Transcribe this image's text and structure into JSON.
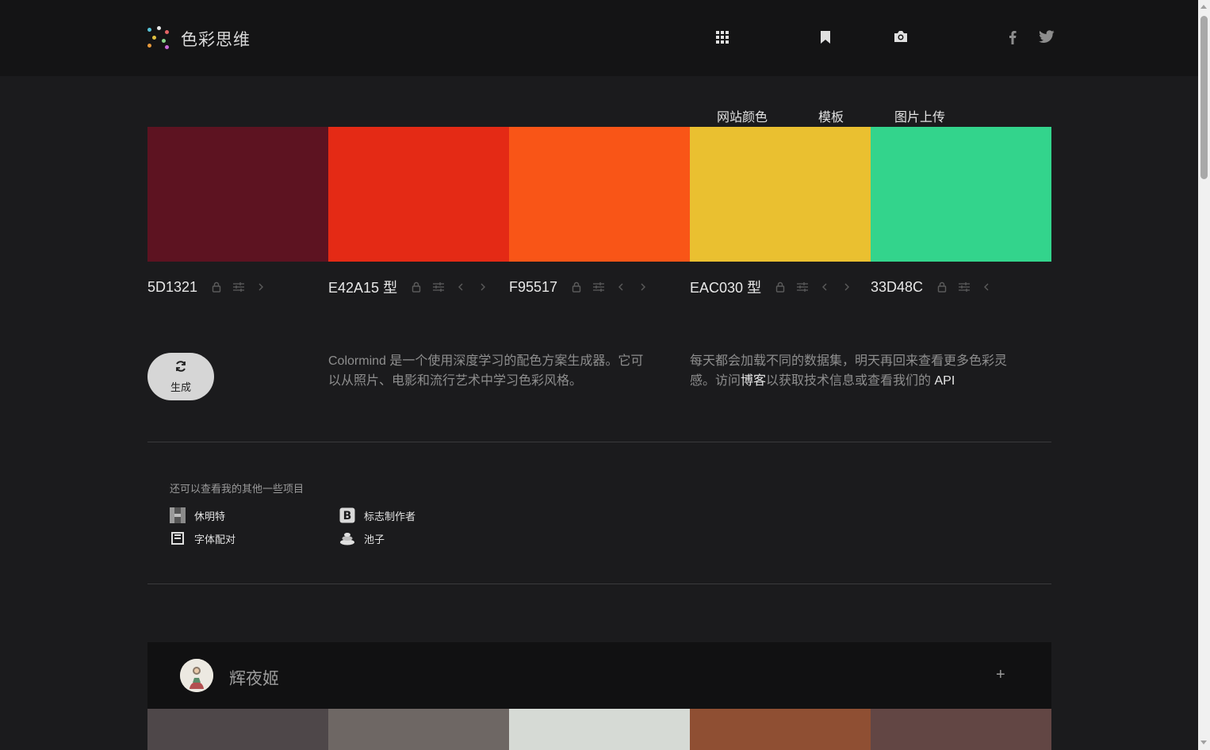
{
  "header": {
    "brand": "色彩思维",
    "nav": [
      {
        "label": "网站颜色",
        "icon": "grid-icon"
      },
      {
        "label": "模板",
        "icon": "bookmark-icon"
      },
      {
        "label": "图片上传",
        "icon": "camera-icon"
      }
    ],
    "social": [
      "facebook-icon",
      "twitter-icon"
    ]
  },
  "palette": {
    "colors": [
      {
        "hex": "5D1321",
        "color": "#5D1321",
        "suffix": ""
      },
      {
        "hex": "E42A15",
        "color": "#E42A15",
        "suffix": "型"
      },
      {
        "hex": "F95517",
        "color": "#F95517",
        "suffix": ""
      },
      {
        "hex": "EAC030",
        "color": "#EAC030",
        "suffix": "型"
      },
      {
        "hex": "33D48C",
        "color": "#33D48C",
        "suffix": ""
      }
    ]
  },
  "generate": {
    "label": "生成",
    "icon": "refresh-icon"
  },
  "about": {
    "left": "Colormind 是一个使用深度学习的配色方案生成器。它可以从照片、电影和流行艺术中学习色彩风格。",
    "right_pre": "每天都会加载不同的数据集，明天再回来查看更多色彩灵感。访问",
    "right_link1": "博客",
    "right_mid": "以获取技术信息或查看我们的 ",
    "right_link2": "API"
  },
  "projects": {
    "title": "还可以查看我的其他一些项目",
    "items": [
      {
        "label": "休明特",
        "icon": "huemint-icon"
      },
      {
        "label": "标志制作者",
        "icon": "logo-maker-icon"
      },
      {
        "label": "字体配对",
        "icon": "font-pair-icon"
      },
      {
        "label": "池子",
        "icon": "pool-icon"
      }
    ]
  },
  "card": {
    "name": "辉夜姬",
    "add": "+",
    "colors": [
      "#4E4749",
      "#6E6764",
      "#D6DAD5",
      "#8F4F33",
      "#624644"
    ]
  }
}
